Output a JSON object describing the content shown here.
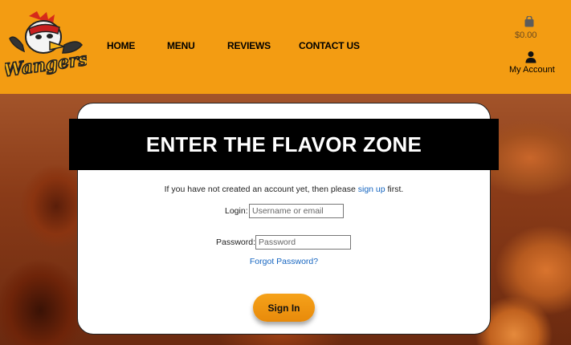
{
  "brand": {
    "logo_text": "Wangers",
    "accent_color": "#f39c12"
  },
  "nav": {
    "home": "HOME",
    "menu": "MENU",
    "reviews": "REVIEWS",
    "contact": "CONTACT US"
  },
  "cart": {
    "icon": "shopping-bag-icon",
    "amount": "$0.00"
  },
  "account": {
    "icon": "user-icon",
    "label": "My Account"
  },
  "login_card": {
    "title": "ENTER THE FLAVOR ZONE",
    "intro_before": "If you have not created an account yet, then please ",
    "signup_link": "sign up",
    "intro_after": " first.",
    "login_label": "Login:",
    "login_placeholder": "Username or email",
    "password_label": "Password:",
    "password_placeholder": "Password",
    "forgot_link": "Forgot Password?",
    "signin_button": "Sign In"
  }
}
